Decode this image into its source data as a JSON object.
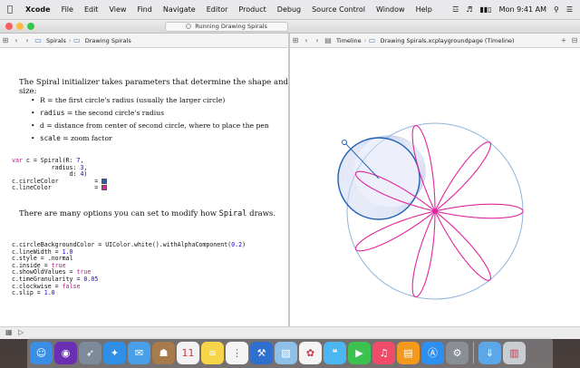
{
  "menubar": {
    "app": "Xcode",
    "items": [
      "File",
      "Edit",
      "View",
      "Find",
      "Navigate",
      "Editor",
      "Product",
      "Debug",
      "Source Control",
      "Window",
      "Help"
    ],
    "clock": "Mon 9:41 AM"
  },
  "toolbar": {
    "status": "Running Drawing Spirals"
  },
  "left_jumpbar": {
    "crumbs": [
      "Spirals",
      "Drawing Spirals"
    ]
  },
  "right_jumpbar": {
    "crumbs": [
      "Timeline",
      "Drawing Spirals.xcplaygroundpage (Timeline)"
    ]
  },
  "editor": {
    "intro": "The Spiral initializer takes parameters that determine the shape and size:",
    "bullets": [
      {
        "term": "R",
        "desc": "= the first circle's radius (usually the larger circle)"
      },
      {
        "term": "radius",
        "desc": "= the second circle's radius"
      },
      {
        "term": "d",
        "desc": "= distance from center of second circle, where to place the pen"
      },
      {
        "term": "scale",
        "desc": "= zoom factor"
      }
    ],
    "code1": {
      "line1_kw": "var",
      "line1_rest": " c = Spiral(R: ",
      "line1_num": "7",
      "line1_end": ",",
      "line2": "           radius: ",
      "line2_num": "3",
      "line2_end": ",",
      "line3": "                d: ",
      "line3_num": "4",
      "line3_end": ")",
      "line4": "c.circleColor",
      "line4_pad": "          = ",
      "line5": "c.lineColor",
      "line5_pad": "            = "
    },
    "swatch_colors": {
      "circle": "#1f62b5",
      "line": "#e0259c"
    },
    "middle_prefix": "There are many options you can set to modify how ",
    "middle_code": "Spiral",
    "middle_suffix": " draws.",
    "code2": [
      {
        "text": "c.circleBackgroundColor = UIColor.white().withAlphaComponent(",
        "num": "0.2",
        "end": ")"
      },
      {
        "text": "c.lineWidth = ",
        "num": "1.0",
        "end": ""
      },
      {
        "text": "c.style = .normal",
        "num": "",
        "end": ""
      },
      {
        "text": "c.inside = ",
        "kw": "true"
      },
      {
        "text": "c.showOldValues = ",
        "kw": "true"
      },
      {
        "text": "c.timeGranularity = ",
        "num": "0.05",
        "end": ""
      },
      {
        "text": "c.clockwise = ",
        "kw": "false"
      },
      {
        "text": "c.slip = ",
        "num": "1.0",
        "end": ""
      }
    ]
  },
  "timeline_colors": {
    "outer_circle": "#8fb3dc",
    "inner_circle": "#1f62b5",
    "petals": "#e0259c"
  },
  "dock": {
    "apps": [
      {
        "name": "finder-app",
        "color": "#3a8ee6",
        "glyph": "☺"
      },
      {
        "name": "siri-app",
        "color": "#6b2fb3",
        "glyph": "◉"
      },
      {
        "name": "launchpad-app",
        "color": "#7d8a99",
        "glyph": "➶"
      },
      {
        "name": "safari-app",
        "color": "#2f8fe6",
        "glyph": "✦"
      },
      {
        "name": "mail-app",
        "color": "#4aa0e8",
        "glyph": "✉"
      },
      {
        "name": "contacts-app",
        "color": "#a77b4b",
        "glyph": "☗"
      },
      {
        "name": "calendar-app",
        "color": "#f2f2f2",
        "glyph": "11"
      },
      {
        "name": "notes-app",
        "color": "#f6d54a",
        "glyph": "≡"
      },
      {
        "name": "reminders-app",
        "color": "#f4f4f4",
        "glyph": "⋮"
      },
      {
        "name": "xcode-app",
        "color": "#2f6fd0",
        "glyph": "⚒"
      },
      {
        "name": "preview-app",
        "color": "#8fc0e8",
        "glyph": "▧"
      },
      {
        "name": "photos-app",
        "color": "#f4f4f4",
        "glyph": "✿"
      },
      {
        "name": "messages-app",
        "color": "#4bb6ef",
        "glyph": "❝"
      },
      {
        "name": "facetime-app",
        "color": "#3cc24e",
        "glyph": "▶"
      },
      {
        "name": "music-app",
        "color": "#f04c6a",
        "glyph": "♫"
      },
      {
        "name": "ibooks-app",
        "color": "#f39a1c",
        "glyph": "▤"
      },
      {
        "name": "app-store-app",
        "color": "#2d8ff0",
        "glyph": "Ⓐ"
      },
      {
        "name": "system-preferences-app",
        "color": "#8a8f96",
        "glyph": "⚙"
      }
    ],
    "extras": [
      {
        "name": "downloads-folder",
        "color": "#5ba7e8",
        "glyph": "⇓"
      },
      {
        "name": "trash-can",
        "color": "#c9ccd1",
        "glyph": "▥"
      }
    ]
  }
}
